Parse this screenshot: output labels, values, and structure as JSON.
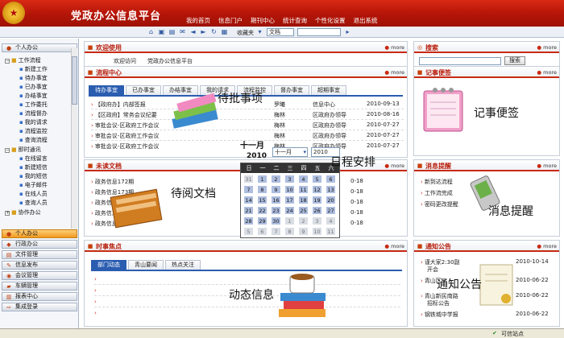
{
  "header": {
    "site_title": "党政办公信息平台",
    "nav": [
      "我的首页",
      "信息门户",
      "期刊中心",
      "统计查询",
      "个性化设置",
      "退出系统"
    ]
  },
  "toolbar": {
    "favorites_label": "收藏夹",
    "doc_select": "文档"
  },
  "sidebar": {
    "personal_office": "个人办公",
    "groups": [
      {
        "label": "工作流程",
        "items": [
          "新建工作",
          "待办事宜",
          "已办事宜",
          "办结事宜",
          "工作委托",
          "流程督办",
          "我的请求",
          "流程监控",
          "查询流程"
        ]
      },
      {
        "label": "即时通讯",
        "items": [
          "在线留言",
          "新建短信",
          "我的短信",
          "电子邮件",
          "在线人员",
          "查询人员"
        ]
      },
      {
        "label": "协作办公",
        "items": []
      }
    ],
    "sections": [
      {
        "label": "个人办公",
        "active": true
      },
      {
        "label": "行政办公",
        "active": false
      },
      {
        "label": "文件管理",
        "active": false
      },
      {
        "label": "信息发布",
        "active": false
      },
      {
        "label": "会议管理",
        "active": false
      },
      {
        "label": "车辆管理",
        "active": false
      },
      {
        "label": "报表中心",
        "active": false
      },
      {
        "label": "集成登录",
        "active": false
      }
    ]
  },
  "more_label": "more",
  "welcome": {
    "title": "欢迎使用",
    "text": "欢迎访问　　党政办公信息平台"
  },
  "workflow": {
    "title": "流程中心",
    "tabs": [
      "待办事宜",
      "已办事宜",
      "办结事宜",
      "我的请求",
      "流程监控",
      "督办事宜",
      "超期事宜"
    ],
    "rows": [
      {
        "title": "【政府办】内部签报",
        "person": "罗曦",
        "dept": "信息中心",
        "date": "2010-09-13"
      },
      {
        "title": "【区政府】常务会议纪要",
        "person": "梅林",
        "dept": "区政府办领导",
        "date": "2010-08-16"
      },
      {
        "title": "审批会议-区政府工作会议",
        "person": "梅林",
        "dept": "区政府办领导",
        "date": "2010-07-27"
      },
      {
        "title": "审批会议-区政府工作会议",
        "person": "梅林",
        "dept": "区政府办领导",
        "date": "2010-07-27"
      },
      {
        "title": "审批会议-区政府工作会议",
        "person": "梅林",
        "dept": "区政府办领导",
        "date": "2010-07-27"
      }
    ]
  },
  "pending_docs": {
    "title": "未读文档",
    "rows": [
      {
        "title": "政务信息172期",
        "date": "0-18"
      },
      {
        "title": "政务信息173期",
        "date": "0-18"
      },
      {
        "title": "政务信息",
        "date": "0-18"
      },
      {
        "title": "政务信息",
        "date": "0-18"
      },
      {
        "title": "政务信息",
        "date": "0-18"
      }
    ]
  },
  "news": {
    "title": "时事焦点",
    "tabs": [
      "部门动态",
      "青山要闻",
      "热点关注"
    ]
  },
  "search": {
    "title": "搜索",
    "button": "搜索"
  },
  "memo": {
    "title": "记事便签"
  },
  "notices": {
    "title": "消息提醒",
    "rows": [
      "新到达流程",
      "工作流完成",
      "密码更改提醒"
    ]
  },
  "announcements": {
    "title": "通知公告",
    "rows": [
      {
        "title": "谨大家2:30副",
        "date": "2010-10-14",
        "sub": "开会"
      },
      {
        "title": "青山区",
        "date": "2010-06-22",
        "sub": ""
      },
      {
        "title": "青山新民南路",
        "date": "2010-06-22",
        "sub": "招标公告"
      },
      {
        "title": "钢铁城中学报",
        "date": "2010-06-22",
        "sub": ""
      }
    ]
  },
  "calendar": {
    "month_label": "十一月",
    "year_label": "2010",
    "month_select": "十一月",
    "year_select": "2010",
    "weekdays": [
      "日",
      "一",
      "二",
      "三",
      "四",
      "五",
      "六"
    ],
    "weeks": [
      [
        "31",
        "1",
        "2",
        "3",
        "4",
        "5",
        "6"
      ],
      [
        "7",
        "8",
        "9",
        "10",
        "11",
        "12",
        "13"
      ],
      [
        "14",
        "15",
        "16",
        "17",
        "18",
        "19",
        "20"
      ],
      [
        "21",
        "22",
        "23",
        "24",
        "25",
        "26",
        "27"
      ],
      [
        "28",
        "29",
        "30",
        "1",
        "2",
        "3",
        "4"
      ],
      [
        "5",
        "6",
        "7",
        "8",
        "9",
        "10",
        "11"
      ]
    ],
    "other_month": [
      [
        0
      ],
      [],
      [],
      [],
      [
        3,
        4,
        5,
        6
      ],
      [
        0,
        1,
        2,
        3,
        4,
        5,
        6
      ]
    ]
  },
  "overlays": {
    "pending_tasks": "待批事项",
    "schedule": "日程安排",
    "docs": "待阅文档",
    "memo": "记事便签",
    "notice": "消息提醒",
    "news": "动态信息",
    "announce": "通知公告"
  },
  "status": {
    "text": "可信站点"
  }
}
